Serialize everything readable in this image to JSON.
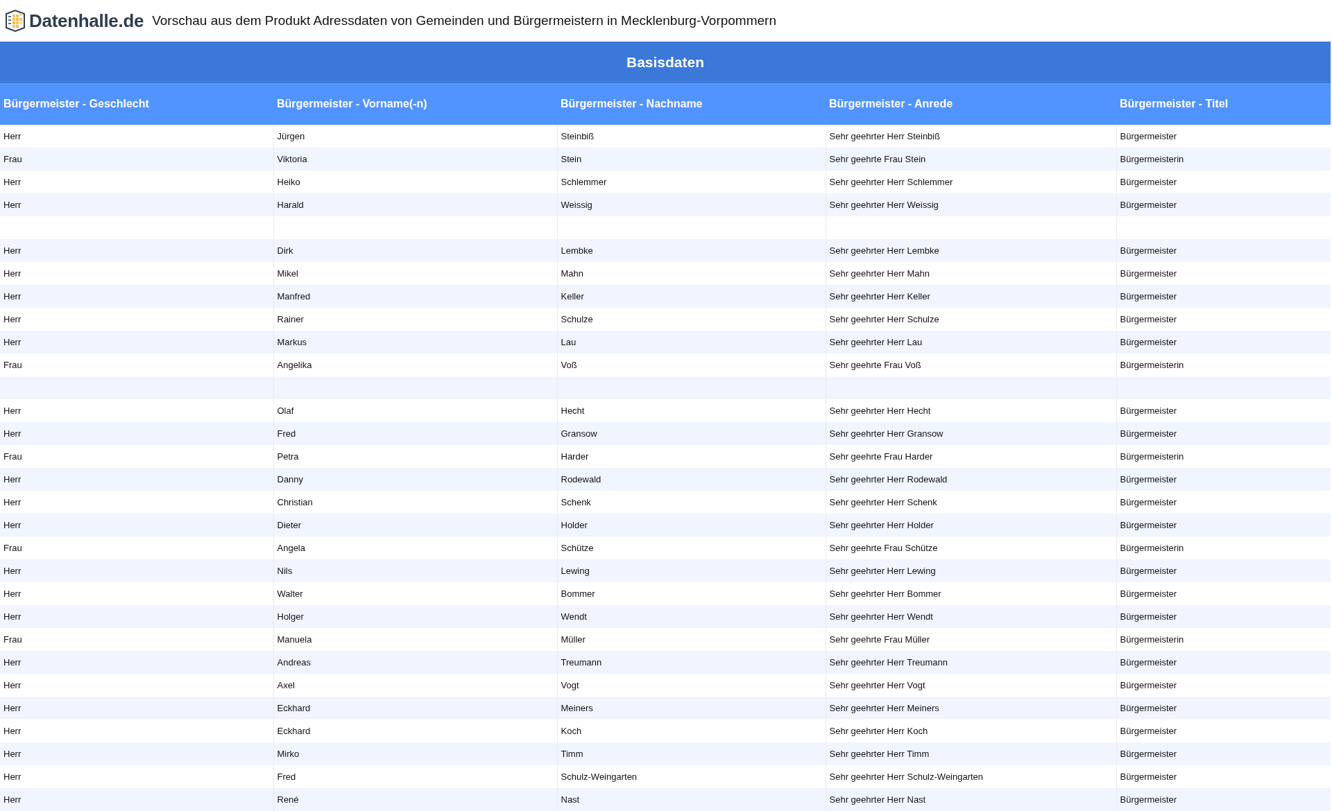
{
  "header": {
    "logo": "Datenhalle.de",
    "title": "Vorschau aus dem Produkt Adressdaten von Gemeinden und Bürgermeistern in Mecklenburg-Vorpommern"
  },
  "table": {
    "caption": "Basisdaten",
    "columns": [
      "Bürgermeister - Geschlecht",
      "Bürgermeister - Vorname(-n)",
      "Bürgermeister - Nachname",
      "Bürgermeister - Anrede",
      "Bürgermeister - Titel"
    ],
    "rows": [
      [
        "Herr",
        "Jürgen",
        "Steinbiß",
        "Sehr geehrter Herr Steinbiß",
        "Bürgermeister"
      ],
      [
        "Frau",
        "Viktoria",
        "Stein",
        "Sehr geehrte Frau Stein",
        "Bürgermeisterin"
      ],
      [
        "Herr",
        "Heiko",
        "Schlemmer",
        "Sehr geehrter Herr Schlemmer",
        "Bürgermeister"
      ],
      [
        "Herr",
        "Harald",
        "Weissig",
        "Sehr geehrter Herr Weissig",
        "Bürgermeister"
      ],
      [],
      [
        "Herr",
        "Dirk",
        "Lembke",
        "Sehr geehrter Herr Lembke",
        "Bürgermeister"
      ],
      [
        "Herr",
        "Mikel",
        "Mahn",
        "Sehr geehrter Herr Mahn",
        "Bürgermeister"
      ],
      [
        "Herr",
        "Manfred",
        "Keller",
        "Sehr geehrter Herr Keller",
        "Bürgermeister"
      ],
      [
        "Herr",
        "Rainer",
        "Schulze",
        "Sehr geehrter Herr Schulze",
        "Bürgermeister"
      ],
      [
        "Herr",
        "Markus",
        "Lau",
        "Sehr geehrter Herr Lau",
        "Bürgermeister"
      ],
      [
        "Frau",
        "Angelika",
        "Voß",
        "Sehr geehrte Frau Voß",
        "Bürgermeisterin"
      ],
      [],
      [
        "Herr",
        "Olaf",
        "Hecht",
        "Sehr geehrter Herr Hecht",
        "Bürgermeister"
      ],
      [
        "Herr",
        "Fred",
        "Gransow",
        "Sehr geehrter Herr Gransow",
        "Bürgermeister"
      ],
      [
        "Frau",
        "Petra",
        "Harder",
        "Sehr geehrte Frau Harder",
        "Bürgermeisterin"
      ],
      [
        "Herr",
        "Danny",
        "Rodewald",
        "Sehr geehrter Herr Rodewald",
        "Bürgermeister"
      ],
      [
        "Herr",
        "Christian",
        "Schenk",
        "Sehr geehrter Herr Schenk",
        "Bürgermeister"
      ],
      [
        "Herr",
        "Dieter",
        "Holder",
        "Sehr geehrter Herr Holder",
        "Bürgermeister"
      ],
      [
        "Frau",
        "Angela",
        "Schütze",
        "Sehr geehrte Frau Schütze",
        "Bürgermeisterin"
      ],
      [
        "Herr",
        "Nils",
        "Lewing",
        "Sehr geehrter Herr Lewing",
        "Bürgermeister"
      ],
      [
        "Herr",
        "Walter",
        "Bommer",
        "Sehr geehrter Herr Bommer",
        "Bürgermeister"
      ],
      [
        "Herr",
        "Holger",
        "Wendt",
        "Sehr geehrter Herr Wendt",
        "Bürgermeister"
      ],
      [
        "Frau",
        "Manuela",
        "Müller",
        "Sehr geehrte Frau Müller",
        "Bürgermeisterin"
      ],
      [
        "Herr",
        "Andreas",
        "Treumann",
        "Sehr geehrter Herr Treumann",
        "Bürgermeister"
      ],
      [
        "Herr",
        "Axel",
        "Vogt",
        "Sehr geehrter Herr Vogt",
        "Bürgermeister"
      ],
      [
        "Herr",
        "Eckhard",
        "Meiners",
        "Sehr geehrter Herr Meiners",
        "Bürgermeister"
      ],
      [
        "Herr",
        "Eckhard",
        "Koch",
        "Sehr geehrter Herr Koch",
        "Bürgermeister"
      ],
      [
        "Herr",
        "Mirko",
        "Timm",
        "Sehr geehrter Herr Timm",
        "Bürgermeister"
      ],
      [
        "Herr",
        "Fred",
        "Schulz-Weingarten",
        "Sehr geehrter Herr Schulz-Weingarten",
        "Bürgermeister"
      ],
      [
        "Herr",
        "René",
        "Nast",
        "Sehr geehrter Herr Nast",
        "Bürgermeister"
      ]
    ]
  }
}
